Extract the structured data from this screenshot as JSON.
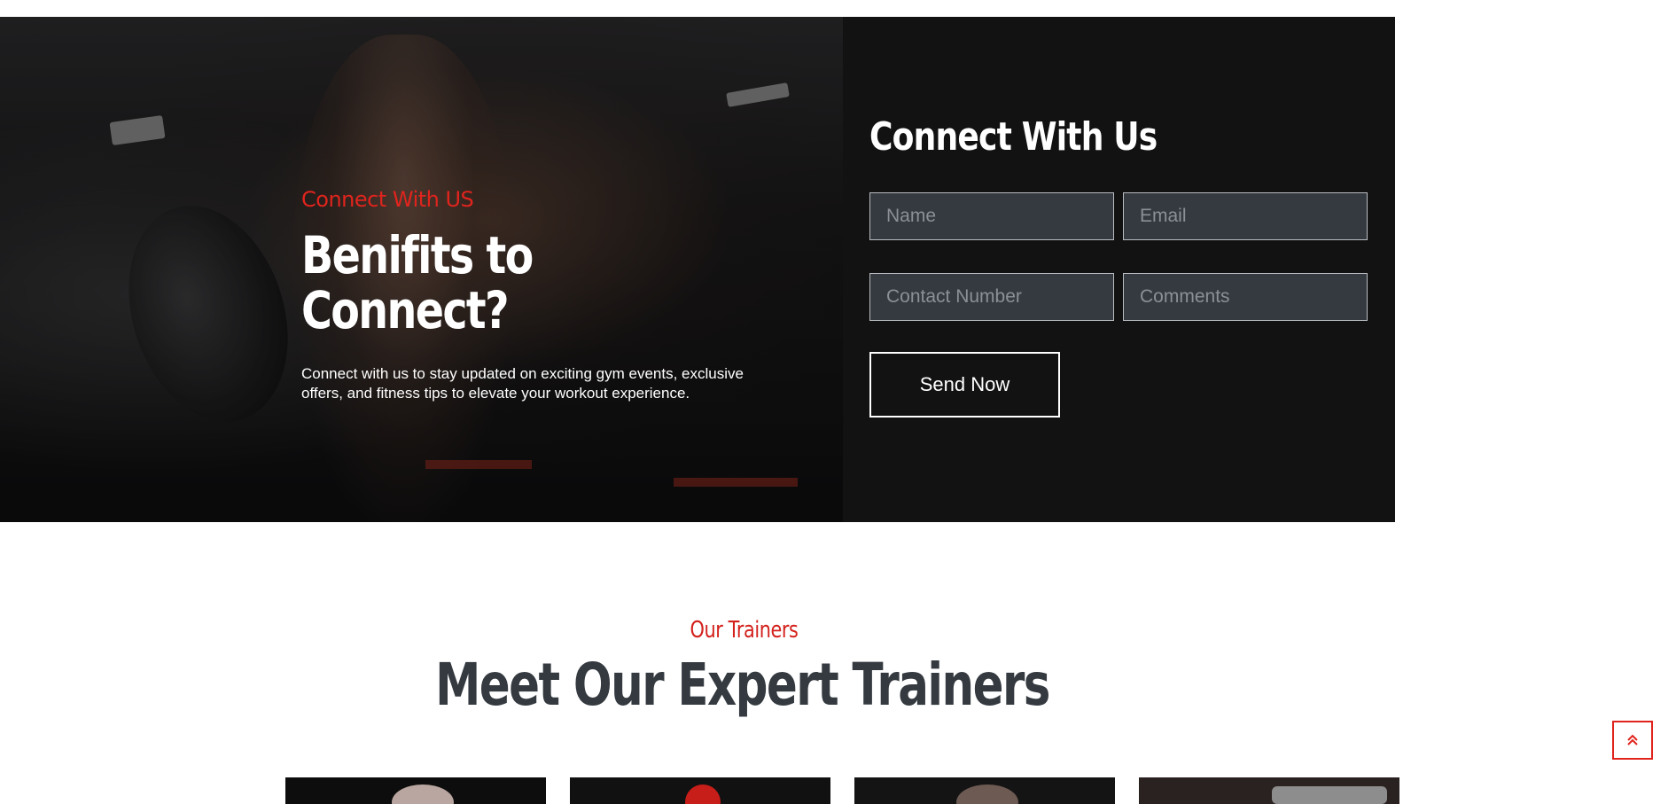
{
  "connect_section": {
    "eyebrow": "Connect With US",
    "heading": "Benifits to Connect?",
    "description": "Connect with us to stay updated on exciting gym events, exclusive offers, and fitness tips to elevate your workout experience."
  },
  "contact_form": {
    "title": "Connect With Us",
    "name_placeholder": "Name",
    "email_placeholder": "Email",
    "contact_placeholder": "Contact Number",
    "comments_placeholder": "Comments",
    "submit_label": "Send Now"
  },
  "trainers_section": {
    "eyebrow": "Our Trainers",
    "heading": "Meet Our Expert Trainers"
  },
  "colors": {
    "accent": "#e0241d",
    "panel": "#121212",
    "input_bg": "#343a40",
    "heading_dark": "#343a40"
  },
  "icons": {
    "scroll_top": "double-chevron-up-icon"
  }
}
